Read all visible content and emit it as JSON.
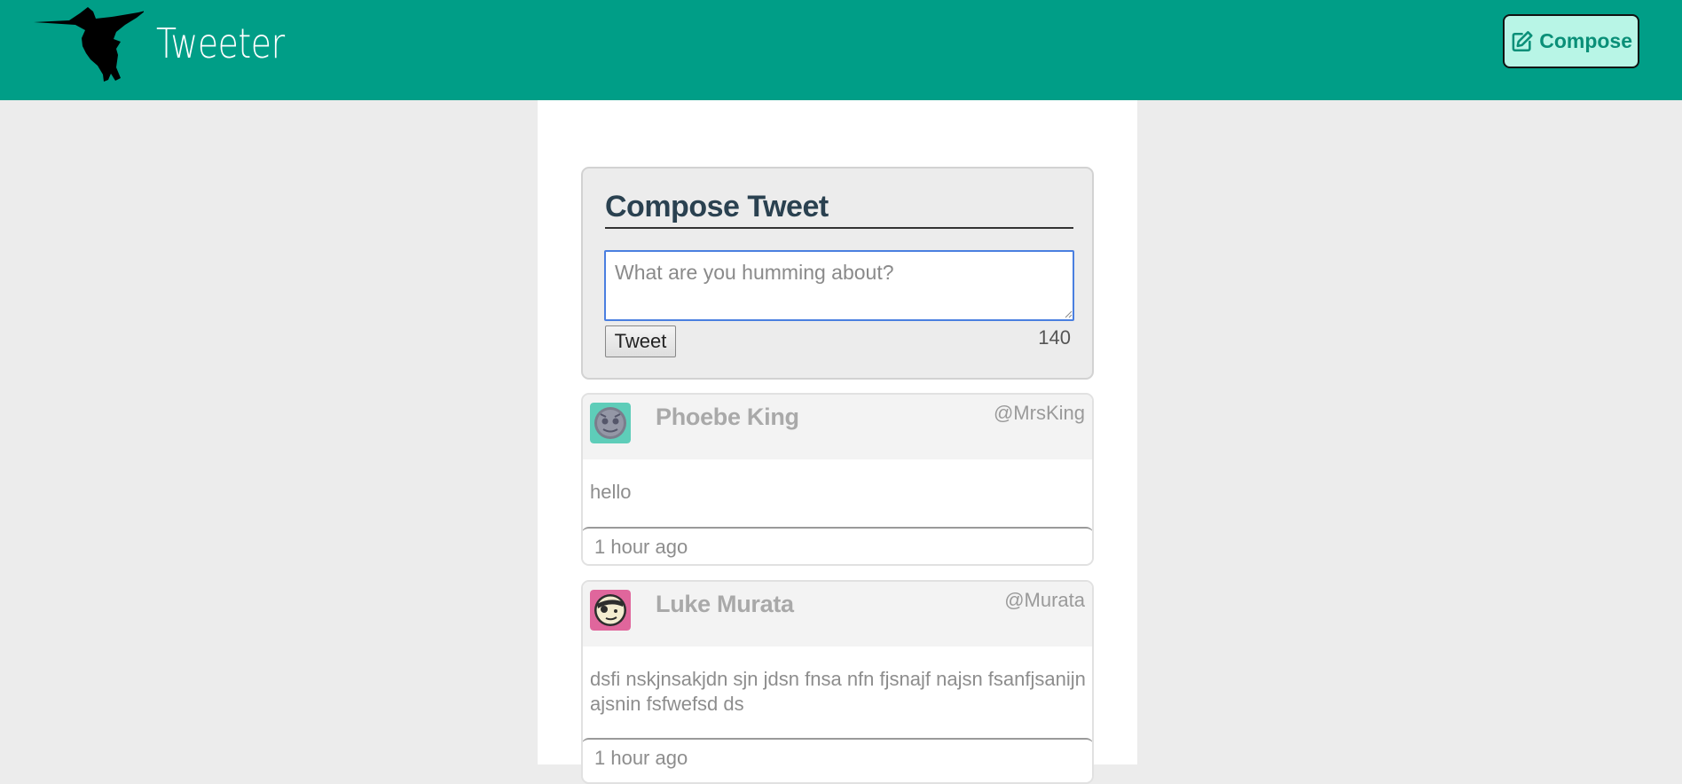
{
  "navbar": {
    "brand": "Tweeter",
    "compose_label": "Compose",
    "colors": {
      "background": "#009e87",
      "button_bg": "#b8f5e6",
      "button_text": "#0a8f78"
    }
  },
  "compose": {
    "title": "Compose Tweet",
    "placeholder": "What are you humming about?",
    "submit_label": "Tweet",
    "counter": "140"
  },
  "tweets": [
    {
      "name": "Phoebe King",
      "handle": "@MrsKing",
      "content": "hello",
      "time": "1 hour ago",
      "avatar_icon": "avatar-alien-icon",
      "avatar_color": "#5ecdb9"
    },
    {
      "name": "Luke Murata",
      "handle": "@Murata",
      "content": "dsfi nskjnsakjdn sjn jdsn fnsa nfn fjsnajf najsn fsanfjsanijn ajsnin fsfwefsd ds",
      "time": "1 hour ago",
      "avatar_icon": "avatar-pirate-icon",
      "avatar_color": "#e0669c"
    }
  ]
}
